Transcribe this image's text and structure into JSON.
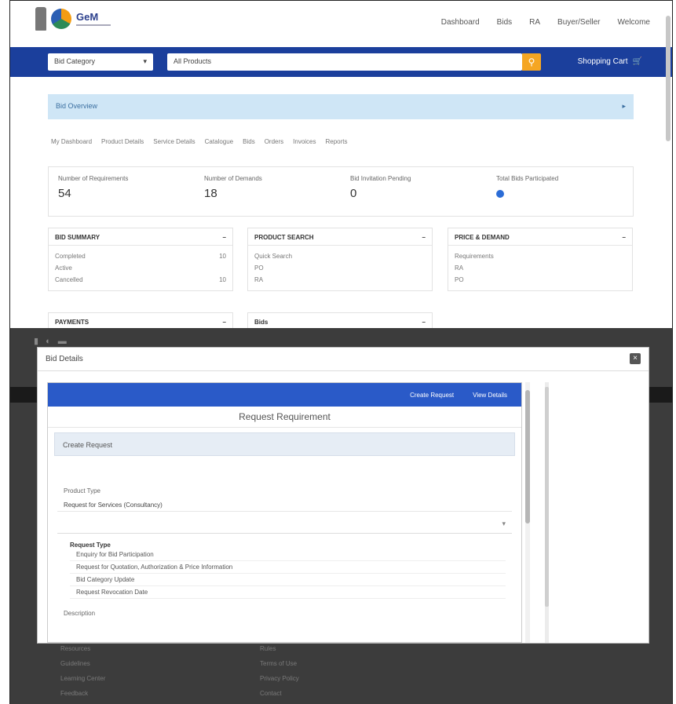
{
  "nav": {
    "logo_text": "GeM",
    "items": [
      "Dashboard",
      "Bids",
      "RA",
      "Buyer/Seller",
      "Welcome"
    ]
  },
  "searchbar": {
    "category_placeholder": "Bid Category",
    "search_placeholder": "All Products",
    "cart_label": "Shopping Cart"
  },
  "bid_banner": {
    "text": "Bid Overview"
  },
  "breadcrumbs": [
    "My Dashboard",
    "Product Details",
    "Service Details",
    "Catalogue",
    "Bids",
    "Orders",
    "Invoices",
    "Reports"
  ],
  "stats": [
    {
      "label": "Number of Requirements",
      "value": "54"
    },
    {
      "label": "Number of Demands",
      "value": "18"
    },
    {
      "label": "Bid Invitation Pending",
      "value": "0"
    },
    {
      "label": "Total Bids Participated",
      "value": ""
    }
  ],
  "panels": [
    {
      "title": "BID SUMMARY",
      "rows": [
        [
          "Completed",
          "10"
        ],
        [
          "Active",
          ""
        ],
        [
          "Cancelled",
          "10"
        ]
      ]
    },
    {
      "title": "PRODUCT SEARCH",
      "rows": [
        [
          "Quick Search",
          ""
        ],
        [
          "PO",
          ""
        ],
        [
          "RA",
          ""
        ]
      ]
    },
    {
      "title": "PRICE & DEMAND",
      "rows": [
        [
          "Requirements",
          ""
        ],
        [
          "RA",
          ""
        ],
        [
          "PO",
          ""
        ]
      ]
    },
    {
      "title": "PAYMENTS",
      "rows": []
    },
    {
      "title": "Bids",
      "rows": []
    }
  ],
  "modal": {
    "title": "Bid Details",
    "close_icon": "×",
    "bar_actions": [
      "Create Request",
      "View Details"
    ],
    "form_title": "Request Requirement",
    "section_title": "Create Request",
    "product_label": "Product Type",
    "product_value": "Request for Services (Consultancy)",
    "list_title": "Request Type",
    "list_items": [
      "Enquiry for Bid Participation",
      "Request for Quotation, Authorization & Price Information",
      "Bid Category Update",
      "Request Revocation Date"
    ],
    "description_label": "Description"
  },
  "footer": {
    "col1": [
      "Resources",
      "Guidelines",
      "Learning Center",
      "Feedback"
    ],
    "col2": [
      "Rules",
      "Terms of Use",
      "Privacy Policy",
      "Contact"
    ]
  }
}
